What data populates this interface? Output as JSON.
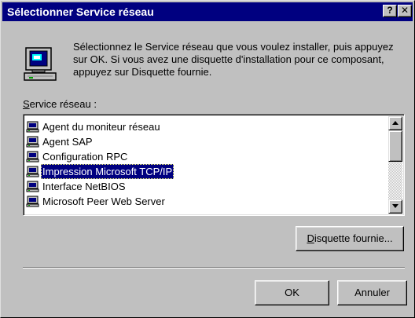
{
  "window": {
    "title": "Sélectionner Service réseau",
    "help_label": "?",
    "close_label": "✕"
  },
  "intro": {
    "text": "Sélectionnez le Service réseau que vous voulez installer, puis appuyez sur OK. Si vous avez une disquette d'installation pour ce composant, appuyez sur Disquette fournie.",
    "icon": "network-component-icon"
  },
  "list": {
    "label_accel": "S",
    "label_rest": "ervice réseau :",
    "items": [
      {
        "label": "Agent du moniteur réseau",
        "icon": "network-service-icon",
        "selected": false
      },
      {
        "label": "Agent SAP",
        "icon": "network-service-icon",
        "selected": false
      },
      {
        "label": "Configuration RPC",
        "icon": "network-service-icon",
        "selected": false
      },
      {
        "label": "Impression Microsoft TCP/IP",
        "icon": "network-service-icon",
        "selected": true
      },
      {
        "label": "Interface NetBIOS",
        "icon": "network-service-icon",
        "selected": false
      },
      {
        "label": "Microsoft Peer Web Server",
        "icon": "network-service-icon",
        "selected": false
      }
    ]
  },
  "buttons": {
    "disk_accel": "D",
    "disk_rest": "isquette fournie...",
    "ok": "OK",
    "cancel": "Annuler"
  },
  "colors": {
    "titlebar": "#000080",
    "face": "#c0c0c0",
    "selection": "#000080"
  }
}
